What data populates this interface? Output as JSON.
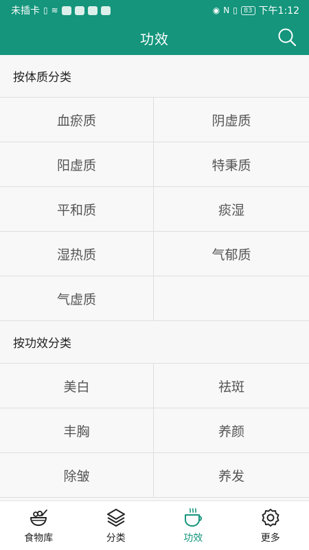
{
  "status_bar": {
    "carrier": "未插卡",
    "battery": "83",
    "time": "下午1:12"
  },
  "header": {
    "title": "功效"
  },
  "sections": [
    {
      "title": "按体质分类",
      "items": [
        "血瘀质",
        "阴虚质",
        "阳虚质",
        "特秉质",
        "平和质",
        "痰湿",
        "湿热质",
        "气郁质",
        "气虚质"
      ]
    },
    {
      "title": "按功效分类",
      "items": [
        "美白",
        "祛斑",
        "丰胸",
        "养颜",
        "除皱",
        "养发"
      ]
    }
  ],
  "bottom_nav": [
    {
      "label": "食物库",
      "icon": "food-bowl-icon"
    },
    {
      "label": "分类",
      "icon": "layers-icon"
    },
    {
      "label": "功效",
      "icon": "cup-icon"
    },
    {
      "label": "更多",
      "icon": "gear-icon"
    }
  ],
  "colors": {
    "primary": "#14957c",
    "background": "#f7f7f7"
  }
}
